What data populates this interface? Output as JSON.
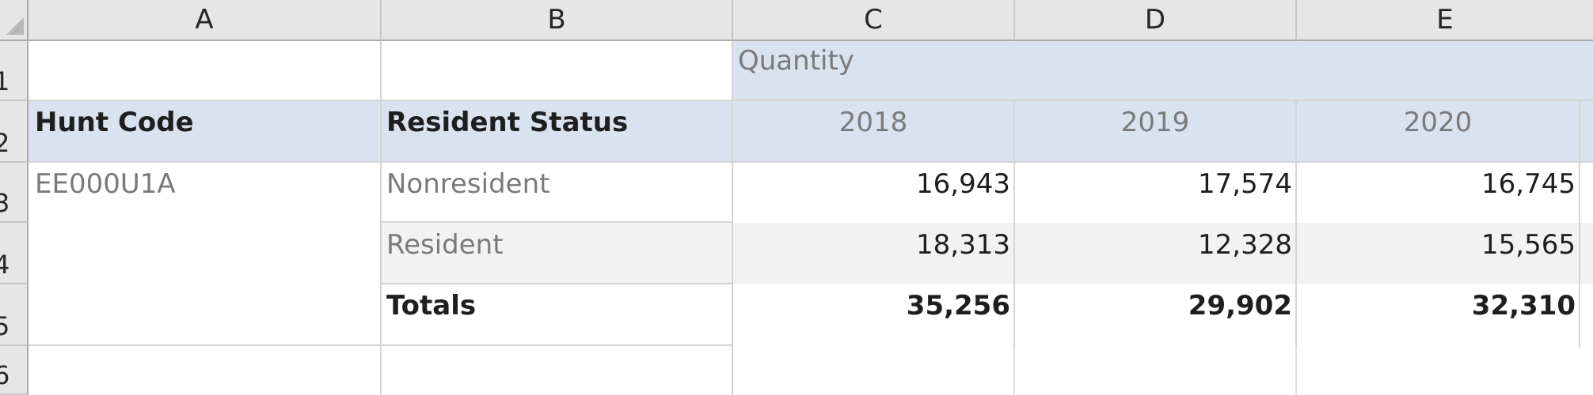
{
  "columns": [
    "A",
    "B",
    "C",
    "D",
    "E"
  ],
  "rows": [
    "1",
    "2",
    "3",
    "4",
    "5",
    "6"
  ],
  "header": {
    "quantity": "Quantity",
    "hunt_code": "Hunt Code",
    "resident_status": "Resident Status",
    "years": [
      "2018",
      "2019",
      "2020"
    ]
  },
  "data": {
    "hunt_code_value": "EE000U1A",
    "rows": [
      {
        "status": "Nonresident",
        "values": [
          "16,943",
          "17,574",
          "16,745"
        ]
      },
      {
        "status": "Resident",
        "values": [
          "18,313",
          "12,328",
          "15,565"
        ]
      },
      {
        "status": "Totals",
        "values": [
          "35,256",
          "29,902",
          "32,310"
        ]
      }
    ]
  },
  "colors": {
    "header_fill": "#d9e3ef",
    "alt_row_fill": "#f2f2f2",
    "sheet_chrome": "#e6e6e6"
  }
}
